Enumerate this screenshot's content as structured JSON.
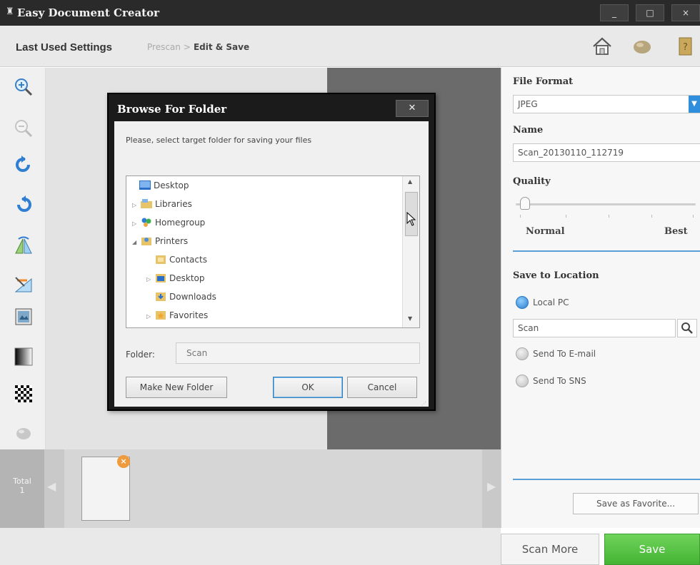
{
  "window": {
    "title": "Easy Document Creator",
    "min": "_",
    "max": "□",
    "close": "×"
  },
  "header": {
    "last_used": "Last Used Settings",
    "crumb_prescan": "Prescan",
    "crumb_sep": ">",
    "crumb_current": "Edit & Save"
  },
  "thumbs": {
    "total_label": "Total",
    "total_count": "1",
    "close": "×"
  },
  "right_panel": {
    "file_format_label": "File Format",
    "file_format_value": "JPEG",
    "name_label": "Name",
    "name_value": "Scan_20130110_112719",
    "quality_label": "Quality",
    "quality_level": 0.0,
    "quality_min": "Normal",
    "quality_max": "Best",
    "save_location_label": "Save to Location",
    "local_pc": "Local PC",
    "folder_value": "Scan",
    "send_email": "Send To E-mail",
    "send_sns": "Send To SNS",
    "save_favorite": "Save as Favorite..."
  },
  "bottom": {
    "scan_more": "Scan More",
    "save": "Save"
  },
  "dialog": {
    "title": "Browse For Folder",
    "close": "✕",
    "message": "Please, select target folder for saving your files",
    "tree": [
      {
        "label": "Desktop",
        "expander": ""
      },
      {
        "label": "Libraries",
        "expander": "▷"
      },
      {
        "label": "Homegroup",
        "expander": "▷"
      },
      {
        "label": "Printers",
        "expander": "◢"
      },
      {
        "label": "Contacts",
        "expander": ""
      },
      {
        "label": "Desktop",
        "expander": "▷"
      },
      {
        "label": "Downloads",
        "expander": ""
      },
      {
        "label": "Favorites",
        "expander": "▷"
      }
    ],
    "folder_label": "Folder:",
    "folder_value": "Scan",
    "make_new_folder": "Make New Folder",
    "ok": "OK",
    "cancel": "Cancel"
  }
}
